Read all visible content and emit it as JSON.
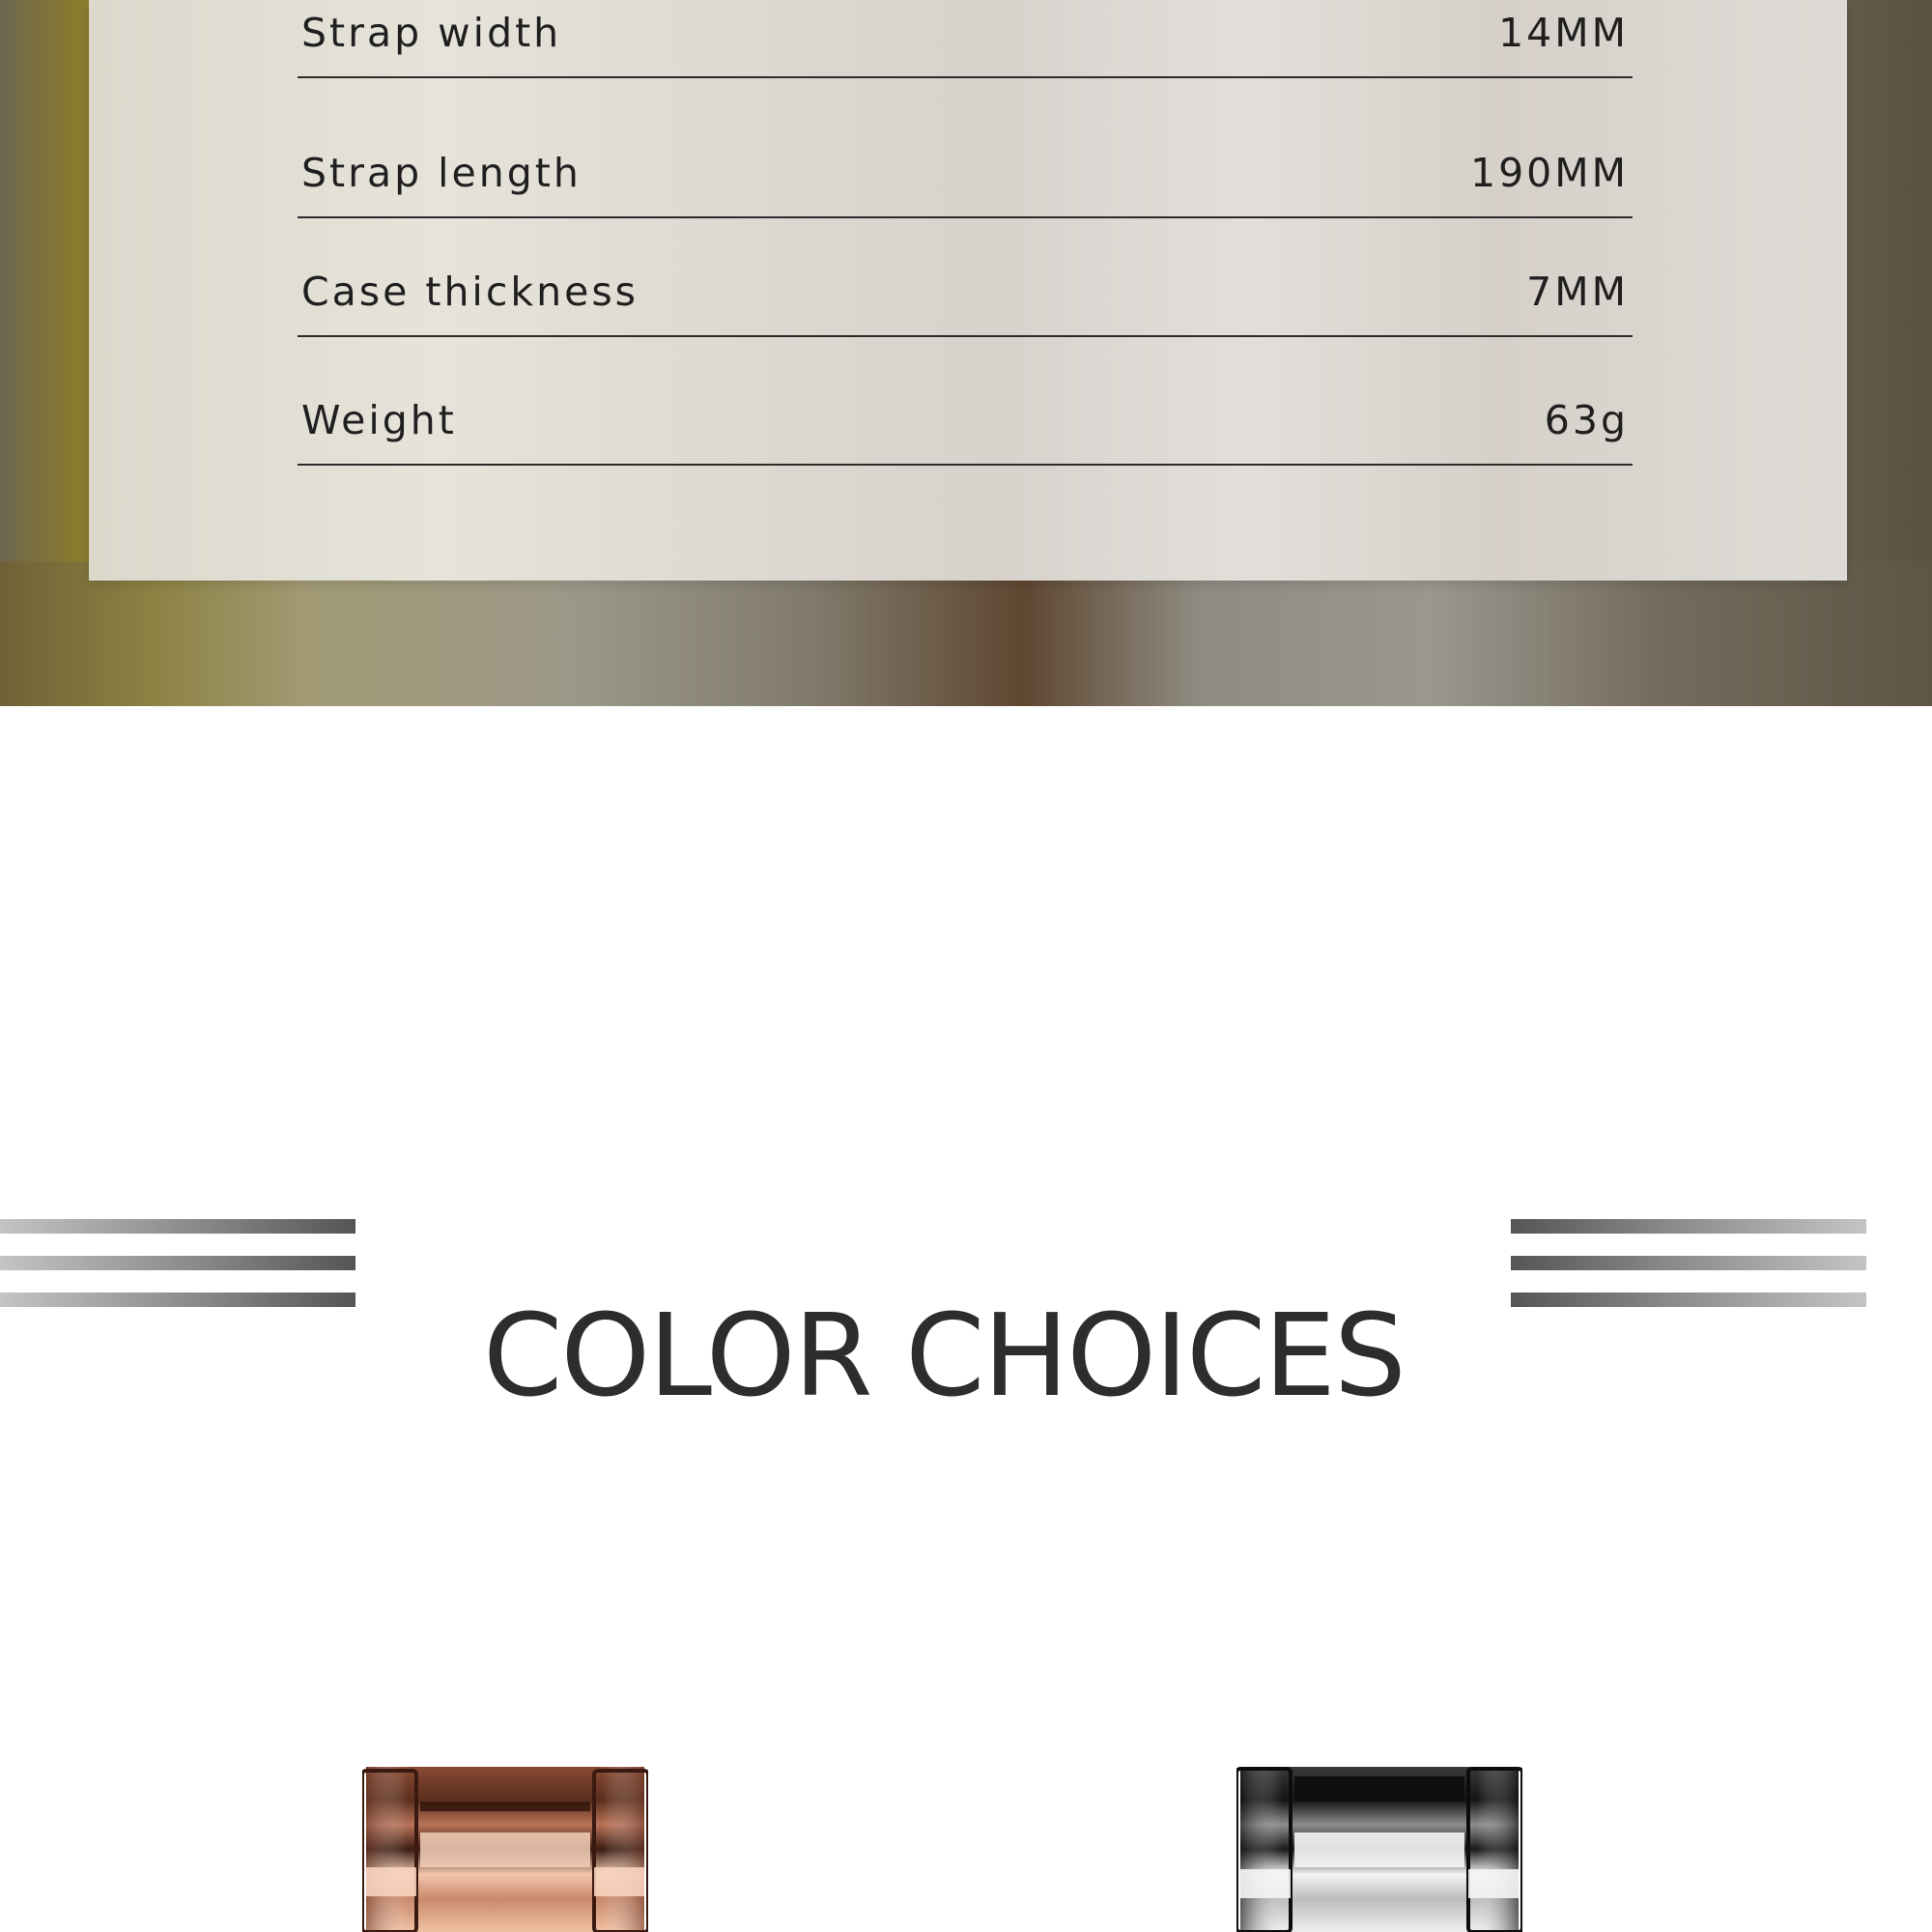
{
  "specs": {
    "rows": [
      {
        "label": "Strap width",
        "value": "14MM"
      },
      {
        "label": "Strap length",
        "value": "190MM"
      },
      {
        "label": "Case thickness",
        "value": "7MM"
      },
      {
        "label": "Weight",
        "value": "63g"
      }
    ]
  },
  "color_section": {
    "title": "COLOR CHOICES",
    "swatches": [
      {
        "name": "rose-gold",
        "colors": {
          "dark": "#5a2e1d",
          "mid": "#a8654a",
          "light": "#f2c6ac"
        }
      },
      {
        "name": "silver-black",
        "colors": {
          "dark": "#141414",
          "mid": "#8d8d8d",
          "light": "#f3f3f3"
        }
      }
    ]
  },
  "theme": {
    "text_dark": "#1f1f1f",
    "heading": "#2d2d2d"
  }
}
